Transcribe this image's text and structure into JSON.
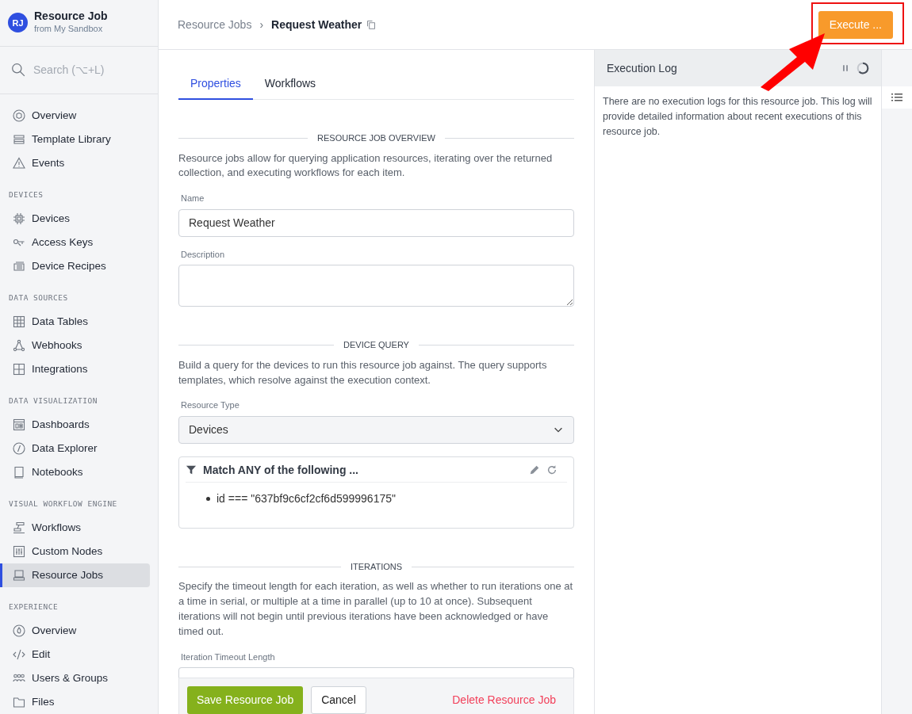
{
  "app": {
    "avatar": "RJ",
    "title": "Resource Job",
    "subtitle": "from My Sandbox"
  },
  "search": {
    "placeholder": "Search (⌥+L)"
  },
  "sidebar": {
    "sections": [
      {
        "items": [
          {
            "label": "Overview",
            "selected": false
          },
          {
            "label": "Template Library",
            "selected": false
          },
          {
            "label": "Events",
            "selected": false
          }
        ]
      },
      {
        "heading": "DEVICES",
        "items": [
          {
            "label": "Devices",
            "selected": false
          },
          {
            "label": "Access Keys",
            "selected": false
          },
          {
            "label": "Device Recipes",
            "selected": false
          }
        ]
      },
      {
        "heading": "DATA SOURCES",
        "items": [
          {
            "label": "Data Tables",
            "selected": false
          },
          {
            "label": "Webhooks",
            "selected": false
          },
          {
            "label": "Integrations",
            "selected": false
          }
        ]
      },
      {
        "heading": "DATA VISUALIZATION",
        "items": [
          {
            "label": "Dashboards",
            "selected": false
          },
          {
            "label": "Data Explorer",
            "selected": false
          },
          {
            "label": "Notebooks",
            "selected": false
          }
        ]
      },
      {
        "heading": "VISUAL WORKFLOW ENGINE",
        "items": [
          {
            "label": "Workflows",
            "selected": false
          },
          {
            "label": "Custom Nodes",
            "selected": false
          },
          {
            "label": "Resource Jobs",
            "selected": true
          }
        ]
      },
      {
        "heading": "EXPERIENCE",
        "items": [
          {
            "label": "Overview",
            "selected": false
          },
          {
            "label": "Edit",
            "selected": false
          },
          {
            "label": "Users & Groups",
            "selected": false
          },
          {
            "label": "Files",
            "selected": false
          }
        ]
      }
    ]
  },
  "breadcrumb": {
    "parent": "Resource Jobs",
    "separator": "›",
    "current": "Request Weather"
  },
  "execute_button": "Execute ...",
  "tabs": [
    {
      "label": "Properties",
      "selected": true
    },
    {
      "label": "Workflows",
      "selected": false
    }
  ],
  "sections": [
    {
      "heading": "RESOURCE JOB OVERVIEW",
      "text": "Resource jobs allow for querying application resources, iterating over the returned collection, and executing workflows for each item."
    },
    {
      "heading": "DEVICE QUERY",
      "text": "Build a query for the devices to run this resource job against. The query supports templates, which resolve against the execution context."
    },
    {
      "heading": "ITERATIONS",
      "text": "Specify the timeout length for each iteration, as well as whether to run iterations one at a time in serial, or multiple at a time in parallel (up to 10 at once). Subsequent iterations will not begin until previous iterations have been acknowledged or have timed out."
    }
  ],
  "fields": {
    "name": {
      "label": "Name",
      "value": "Request Weather"
    },
    "description": {
      "label": "Description"
    },
    "resource_type": {
      "label": "Resource Type",
      "value": "Devices"
    },
    "iteration_timeout": {
      "label": "Iteration Timeout Length"
    }
  },
  "query": {
    "title": "Match ANY of the following ...",
    "conditions": [
      "id === \"637bf9c6cf2cf6d599996175\""
    ]
  },
  "footer": {
    "save": "Save Resource Job",
    "cancel": "Cancel",
    "delete": "Delete Resource Job"
  },
  "log": {
    "title": "Execution Log",
    "empty_text": "There are no execution logs for this resource job. This log will provide detailed information about recent executions of this resource job."
  }
}
